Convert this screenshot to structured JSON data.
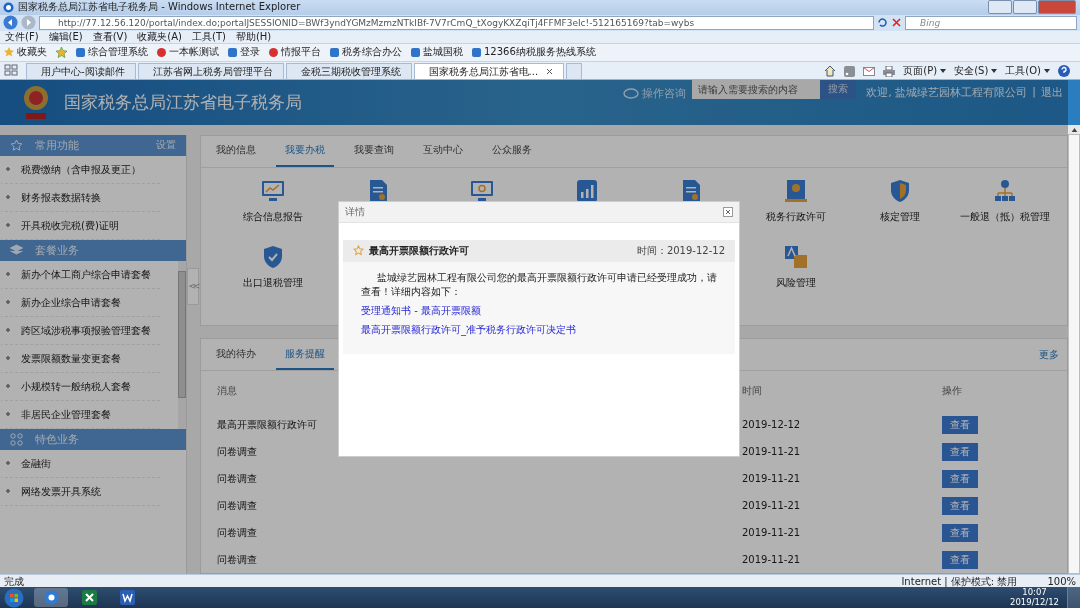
{
  "window": {
    "title": "国家税务总局江苏省电子税务局 - Windows Internet Explorer"
  },
  "address_bar": {
    "url": "http://77.12.56.120/portal/index.do;portalJSESSIONID=BWf3yndYGMzMzmzNTkIBf-7V7rCmQ_tXogyKXZqiTj4FFMF3eIc!-512165169?tab=wybs",
    "search_placeholder": "Bing"
  },
  "menu_bar": [
    "文件(F)",
    "编辑(E)",
    "查看(V)",
    "收藏夹(A)",
    "工具(T)",
    "帮助(H)"
  ],
  "favorites_bar": {
    "label": "收藏夹",
    "items": [
      {
        "label": "综合管理系统",
        "kind": "ie"
      },
      {
        "label": "一本帐测试",
        "kind": "emblem"
      },
      {
        "label": "登录",
        "kind": "ie"
      },
      {
        "label": "情报平台",
        "kind": "emblem"
      },
      {
        "label": "税务综合办公",
        "kind": "ie"
      },
      {
        "label": "盐城国税",
        "kind": "ie"
      },
      {
        "label": "12366纳税服务热线系统",
        "kind": "ie"
      }
    ]
  },
  "browser_tabs": [
    {
      "label": "用户中心-阅读邮件",
      "selected": false
    },
    {
      "label": "江苏省网上税务局管理平台",
      "selected": false
    },
    {
      "label": "金税三期税收管理系统",
      "selected": false
    },
    {
      "label": "国家税务总局江苏省电...",
      "selected": true
    }
  ],
  "command_bar": [
    "页面(P)",
    "安全(S)",
    "工具(O)"
  ],
  "header": {
    "title": "国家税务总局江苏省电子税务局",
    "help": "操作咨询",
    "search_placeholder": "请输入需要搜索的内容",
    "search_button": "搜索",
    "welcome": "欢迎, 盐城绿艺园林工程有限公司",
    "separator": "|",
    "logout": "退出"
  },
  "sidebar": [
    {
      "title": "常用功能",
      "kind": "star",
      "action": "设置",
      "items": [
        "税费缴纳（含申报及更正）",
        "财务报表数据转换",
        "开具税收完税(费)证明"
      ]
    },
    {
      "title": "套餐业务",
      "kind": "layers",
      "items": [
        "新办个体工商户综合申请套餐",
        "新办企业综合申请套餐",
        "跨区域涉税事项报验管理套餐",
        "发票限额数量变更套餐",
        "小规模转一般纳税人套餐",
        "非居民企业管理套餐"
      ]
    },
    {
      "title": "特色业务",
      "kind": "grid",
      "items": [
        "金融街",
        "网络发票开具系统"
      ]
    }
  ],
  "collapse_handle": "<<",
  "main_tabs": [
    {
      "label": "我的信息",
      "selected": false
    },
    {
      "label": "我要办税",
      "selected": true
    },
    {
      "label": "我要查询",
      "selected": false
    },
    {
      "label": "互动中心",
      "selected": false
    },
    {
      "label": "公众服务",
      "selected": false
    }
  ],
  "services": [
    [
      {
        "kind": "monitor-chart",
        "label": "综合信息报告"
      },
      {
        "kind": "document"
      },
      {
        "kind": "monitor"
      },
      {
        "kind": "bar-chart"
      },
      {
        "kind": "file"
      },
      {
        "kind": "certificate",
        "label": "税务行政许可"
      },
      {
        "kind": "shield",
        "label": "核定管理"
      },
      {
        "kind": "network",
        "label": "一般退（抵）税管理"
      }
    ],
    [
      {
        "kind": "shield-check",
        "label": "出口退税管理"
      },
      {
        "kind": "translate",
        "label": "风险管理"
      }
    ]
  ],
  "notice_tabs": [
    {
      "label": "我的待办",
      "selected": false
    },
    {
      "label": "服务提醒",
      "selected": true
    }
  ],
  "more": "更多",
  "table": {
    "columns": [
      "消息",
      "时间",
      "操作"
    ],
    "rows": [
      {
        "message": "最高开票限额行政许可",
        "time": "2019-12-12",
        "action": "查看"
      },
      {
        "message": "问卷调查",
        "time": "2019-11-21",
        "action": "查看"
      },
      {
        "message": "问卷调查",
        "time": "2019-11-21",
        "action": "查看"
      },
      {
        "message": "问卷调查",
        "time": "2019-11-21",
        "action": "查看"
      },
      {
        "message": "问卷调查",
        "time": "2019-11-21",
        "action": "查看"
      },
      {
        "message": "问卷调查",
        "time": "2019-11-21",
        "action": "查看"
      }
    ]
  },
  "dialog": {
    "title": "详情",
    "heading": "最高开票限额行政许可",
    "time": "时间：2019-12-12",
    "body": "盐城绿艺园林工程有限公司您的最高开票限额行政许可申请已经受理成功，请查看！详细内容如下：",
    "links": [
      "受理通知书 - 最高开票限额",
      "最高开票限额行政许可_准予税务行政许可决定书"
    ]
  },
  "status_bar": {
    "text": "完成",
    "zone": "Internet | 保护模式: 禁用",
    "zoom": "100%"
  },
  "taskbar": {
    "time": "10:07",
    "date": "2019/12/12"
  }
}
